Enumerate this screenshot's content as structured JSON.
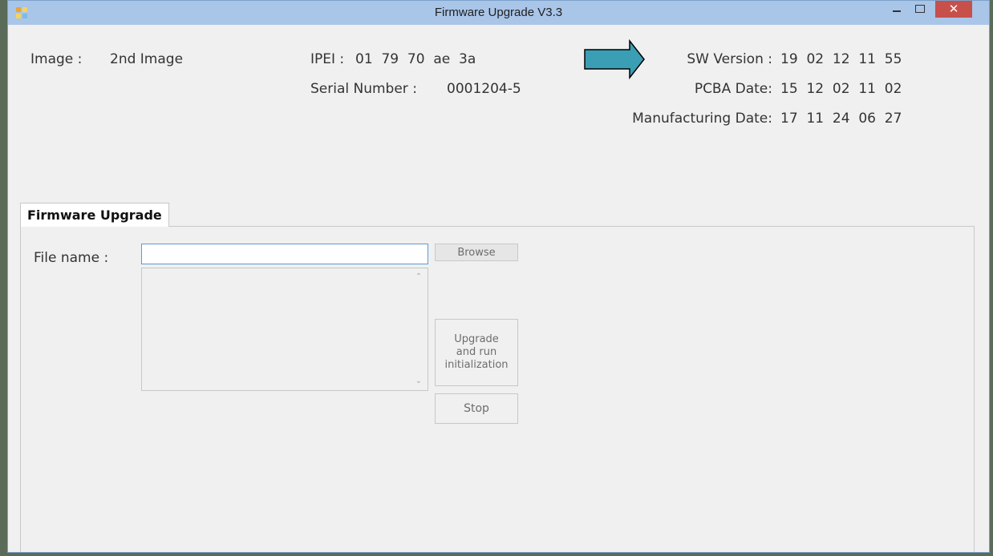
{
  "window": {
    "title": "Firmware Upgrade V3.3",
    "controls": {
      "close_glyph": "✕"
    }
  },
  "info": {
    "image_label": "Image :",
    "image_value": "2nd Image",
    "ipei_label": "IPEI :",
    "ipei_value": "01  79  70  ae  3a",
    "serial_label": "Serial Number :",
    "serial_value": "0001204-5",
    "sw_version_label": "SW Version :",
    "sw_version_value": "19  02  12  11  55",
    "pcba_label": "PCBA Date:",
    "pcba_value": "15  12  02  11  02",
    "mfg_label": "Manufacturing Date:",
    "mfg_value": "17  11  24  06  27"
  },
  "tab": {
    "label": "Firmware Upgrade"
  },
  "form": {
    "file_label": "File name :",
    "file_value": "",
    "browse_label": "Browse",
    "upgrade_label": "Upgrade\nand run\ninitialization",
    "stop_label": "Stop"
  },
  "annotations": {
    "blue_arrow_color": "#3a9fb5",
    "orange_arrow_color": "#f0924a"
  },
  "icons": {
    "app_icon": "app-icon",
    "minimize": "minimize-icon",
    "maximize": "maximize-icon",
    "close": "close-icon",
    "scroll_up": "chevron-up-icon",
    "scroll_down": "chevron-down-icon"
  }
}
